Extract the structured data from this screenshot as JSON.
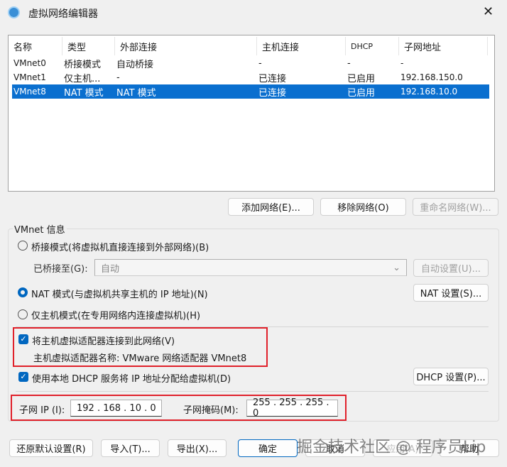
{
  "window": {
    "title": "虚拟网络编辑器",
    "close": "✕"
  },
  "table": {
    "headers": [
      "名称",
      "类型",
      "外部连接",
      "主机连接",
      "DHCP",
      "子网地址"
    ],
    "rows": [
      [
        "VMnet0",
        "桥接模式",
        "自动桥接",
        "-",
        "-",
        "-"
      ],
      [
        "VMnet1",
        "仅主机...",
        "-",
        "已连接",
        "已启用",
        "192.168.150.0"
      ],
      [
        "VMnet8",
        "NAT 模式",
        "NAT 模式",
        "已连接",
        "已启用",
        "192.168.10.0"
      ]
    ],
    "selected_row": 2
  },
  "list_buttons": {
    "add": "添加网络(E)...",
    "remove": "移除网络(O)",
    "rename": "重命名网络(W)..."
  },
  "info": {
    "group_label": "VMnet 信息",
    "bridge": "桥接模式(将虚拟机直接连接到外部网络)(B)",
    "bridged_to_label": "已桥接至(G):",
    "bridged_to_value": "自动",
    "auto_settings": "自动设置(U)...",
    "nat": "NAT 模式(与虚拟机共享主机的 IP 地址)(N)",
    "nat_settings": "NAT 设置(S)...",
    "hostonly": "仅主机模式(在专用网络内连接虚拟机)(H)",
    "connect_adapter": "将主机虚拟适配器连接到此网络(V)",
    "adapter_name": "主机虚拟适配器名称: VMware 网络适配器 VMnet8",
    "dhcp": "使用本地 DHCP 服务将 IP 地址分配给虚拟机(D)",
    "dhcp_settings": "DHCP 设置(P)...",
    "subnet_ip_label": "子网 IP (I):",
    "subnet_ip": "192 . 168 . 10 . 0",
    "mask_label": "子网掩码(M):",
    "mask": "255 . 255 . 255 . 0"
  },
  "footer": {
    "restore": "还原默认设置(R)",
    "import": "导入(T)...",
    "export": "导出(X)...",
    "ok": "确定",
    "cancel": "取消",
    "apply": "应用(A)",
    "help": "帮助"
  },
  "watermark": "掘金技术社区 @ 程序员Lip",
  "colors": {
    "accent": "#0067c0",
    "selection": "#0a6fcf",
    "highlight_box": "#e0202a"
  }
}
